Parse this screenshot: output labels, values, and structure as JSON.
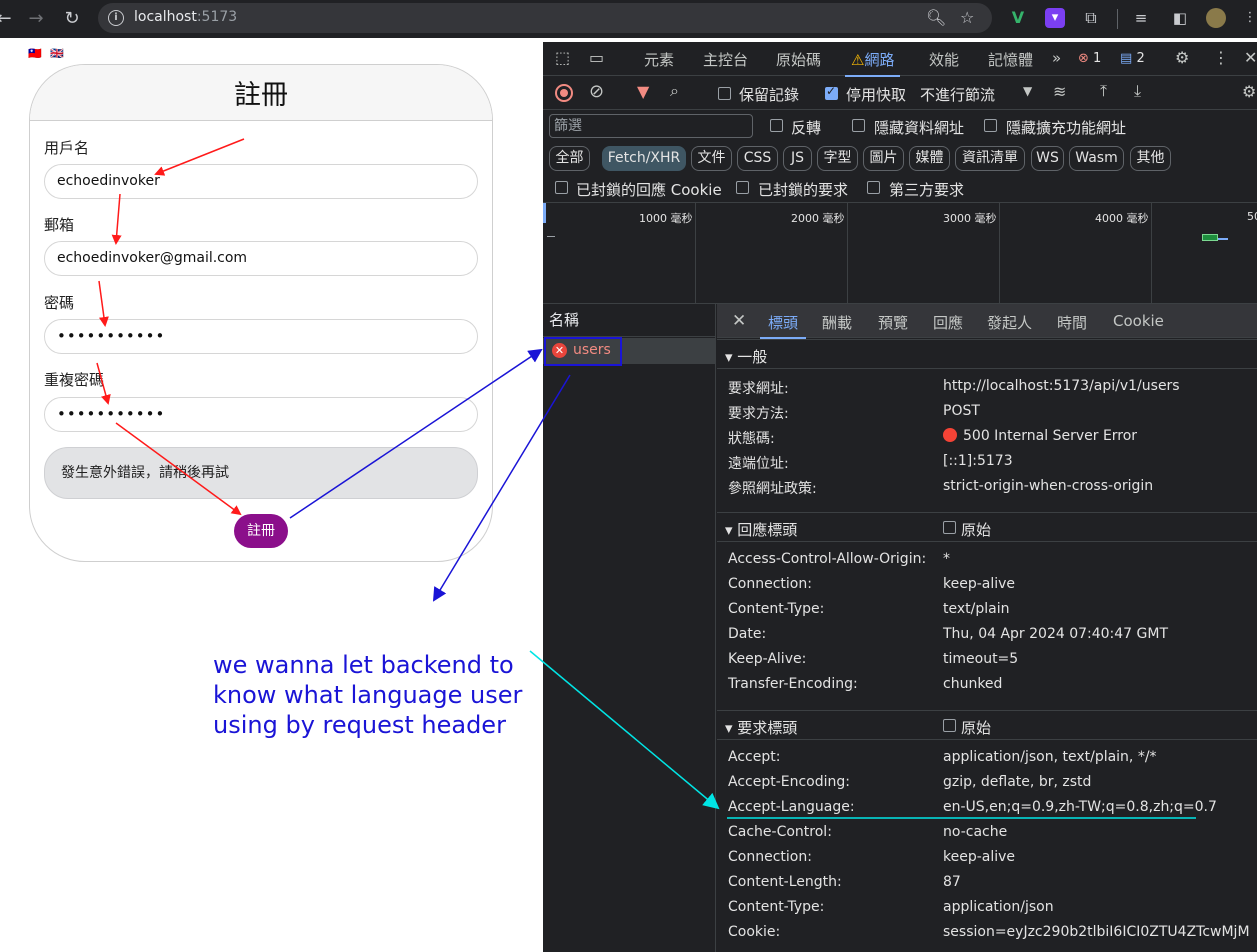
{
  "browser": {
    "url_host": "localhost",
    "url_port": ":5173"
  },
  "page": {
    "flags": [
      "🇹🇼",
      "🇬🇧"
    ],
    "title": "註冊",
    "fields": [
      {
        "label": "用戶名",
        "value": "echoedinvoker"
      },
      {
        "label": "郵箱",
        "value": "echoedinvoker@gmail.com"
      },
      {
        "label": "密碼",
        "value": "•••••••••••"
      },
      {
        "label": "重複密碼",
        "value": "•••••••••••"
      }
    ],
    "error_message": "發生意外錯誤，請稍後再試",
    "submit_label": "註冊",
    "annotation": [
      "we wanna let backend to",
      "know what language user",
      "using by request header"
    ]
  },
  "devtools": {
    "tabs": [
      "元素",
      "主控台",
      "原始碼",
      "網路",
      "效能",
      "記憶體"
    ],
    "error_count": "1",
    "message_count": "2",
    "toolbar": {
      "preserve_log": "保留記錄",
      "disable_cache": "停用快取",
      "throttle": "不進行節流"
    },
    "filter_placeholder": "篩選",
    "filter_options": [
      "反轉",
      "隱藏資料網址",
      "隱藏擴充功能網址"
    ],
    "type_chips": [
      "全部",
      "Fetch/XHR",
      "文件",
      "CSS",
      "JS",
      "字型",
      "圖片",
      "媒體",
      "資訊清單",
      "WS",
      "Wasm",
      "其他"
    ],
    "blocked_options": [
      "已封鎖的回應 Cookie",
      "已封鎖的要求",
      "第三方要求"
    ],
    "timeline_labels": [
      "1000 毫秒",
      "2000 毫秒",
      "3000 毫秒",
      "4000 毫秒",
      "50"
    ],
    "name_header": "名稱",
    "request_name": "users",
    "detail_tabs": [
      "標頭",
      "酬載",
      "預覽",
      "回應",
      "發起人",
      "時間",
      "Cookie"
    ],
    "general": {
      "title": "▾ 一般",
      "rows": [
        {
          "k": "要求網址:",
          "v": "http://localhost:5173/api/v1/users"
        },
        {
          "k": "要求方法:",
          "v": "POST"
        },
        {
          "k": "狀態碼:",
          "v": "500 Internal Server Error"
        },
        {
          "k": "遠端位址:",
          "v": "[::1]:5173"
        },
        {
          "k": "參照網址政策:",
          "v": "strict-origin-when-cross-origin"
        }
      ]
    },
    "response_headers": {
      "title": "▾ 回應標頭",
      "raw": "原始",
      "rows": [
        {
          "k": "Access-Control-Allow-Origin:",
          "v": "*"
        },
        {
          "k": "Connection:",
          "v": "keep-alive"
        },
        {
          "k": "Content-Type:",
          "v": "text/plain"
        },
        {
          "k": "Date:",
          "v": "Thu, 04 Apr 2024 07:40:47 GMT"
        },
        {
          "k": "Keep-Alive:",
          "v": "timeout=5"
        },
        {
          "k": "Transfer-Encoding:",
          "v": "chunked"
        }
      ]
    },
    "request_headers": {
      "title": "▾ 要求標頭",
      "raw": "原始",
      "rows": [
        {
          "k": "Accept:",
          "v": "application/json, text/plain, */*"
        },
        {
          "k": "Accept-Encoding:",
          "v": "gzip, deflate, br, zstd"
        },
        {
          "k": "Accept-Language:",
          "v": "en-US,en;q=0.9,zh-TW;q=0.8,zh;q=0.7"
        },
        {
          "k": "Cache-Control:",
          "v": "no-cache"
        },
        {
          "k": "Connection:",
          "v": "keep-alive"
        },
        {
          "k": "Content-Length:",
          "v": "87"
        },
        {
          "k": "Content-Type:",
          "v": "application/json"
        },
        {
          "k": "Cookie:",
          "v": "session=eyJzc290b2tlbiI6ICI0ZTU4ZTcwMjM"
        }
      ]
    }
  }
}
